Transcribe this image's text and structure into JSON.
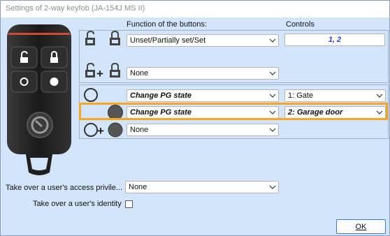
{
  "window": {
    "title": "Settings of 2-way keyfob (JA-154J MS II)"
  },
  "headers": {
    "function": "Function of the buttons:",
    "controls": "Controls"
  },
  "rows": {
    "row1": {
      "function": "Unset/Partially set/Set",
      "controls": "1, 2"
    },
    "row2": {
      "function": "None"
    },
    "row3": {
      "function": "Change PG state",
      "controls": "1: Gate"
    },
    "row4": {
      "function": "Change PG state",
      "controls": "2: Garage door"
    },
    "row5": {
      "function": "None"
    }
  },
  "bottom": {
    "access_label": "Take over a user's access privile...",
    "access_value": "None",
    "identity_label": "Take over a user's identity",
    "identity_checked": false
  },
  "ok_label": "OK",
  "colors": {
    "background": "#d3e5fb",
    "highlight": "#f5a623",
    "controls_text": "#2a3fd0"
  }
}
